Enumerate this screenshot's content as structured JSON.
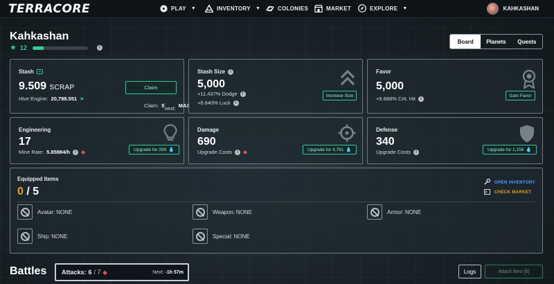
{
  "nav": {
    "logo": "TERRACORE",
    "items": [
      {
        "label": "PLAY",
        "icon": "play-circle-icon",
        "dropdown": true
      },
      {
        "label": "INVENTORY",
        "icon": "rocket-icon",
        "dropdown": true
      },
      {
        "label": "COLONIES",
        "icon": "planet-icon",
        "dropdown": false
      },
      {
        "label": "MARKET",
        "icon": "store-icon",
        "dropdown": false
      },
      {
        "label": "EXPLORE",
        "icon": "compass-icon",
        "dropdown": true
      }
    ],
    "user": "KAHKASHAN"
  },
  "player": {
    "name": "Kahkashan",
    "level": "12",
    "level_progress": 0.2
  },
  "tabs": [
    "Board",
    "Planets",
    "Quests"
  ],
  "active_tab": "Board",
  "stash": {
    "title": "Stash",
    "value": "9.509",
    "unit": "SCRAP",
    "hive_label": "Hive Engine:",
    "hive_value": "20,798.551",
    "claim_button": "Claim",
    "claim_label": "Claim:",
    "claim_count": "5",
    "next_label": ", next:",
    "next_value": "MAX"
  },
  "stash_size": {
    "title": "Stash Size",
    "value": "5,000",
    "dodge": "+11.437% Dodge",
    "luck": "+6.640% Luck",
    "button": "Increase Size"
  },
  "favor": {
    "title": "Favor",
    "value": "5,000",
    "crit": "+9.688% Crit. Hit",
    "button": "Gain Favor"
  },
  "engineering": {
    "title": "Engineering",
    "value": "17",
    "rate_label": "Mine Rate:",
    "rate_value": "5.85984/h",
    "button": "Upgrade for 289"
  },
  "damage": {
    "title": "Damage",
    "value": "690",
    "costs": "Upgrade Costs",
    "button": "Upgrade for 4,761"
  },
  "defense": {
    "title": "Defense",
    "value": "340",
    "costs": "Upgrade Costs",
    "button": "Upgrade for 1,156"
  },
  "equipped": {
    "title": "Equipped Items",
    "count": "0",
    "total": "/ 5",
    "open_inventory": "OPEN INVENTORY",
    "check_market": "CHECK MARKET",
    "slots": [
      {
        "label": "Avatar:",
        "value": "NONE"
      },
      {
        "label": "Weapon:",
        "value": "NONE"
      },
      {
        "label": "Armor:",
        "value": "NONE"
      },
      {
        "label": "Ship:",
        "value": "NONE"
      },
      {
        "label": "Special:",
        "value": "NONE"
      }
    ]
  },
  "battles": {
    "title": "Battles",
    "attacks_label": "Attacks:",
    "attacks_value": "6",
    "attacks_max": "/ 7",
    "next_label": "Next:",
    "next_value": "-1h 57m",
    "logs_button": "Logs",
    "attack_best_button": "Attack Best [6]"
  },
  "colors": {
    "accent": "#38c99a",
    "warning": "#f0a020",
    "danger": "#e2534c",
    "link_blue": "#4ba3ff"
  }
}
